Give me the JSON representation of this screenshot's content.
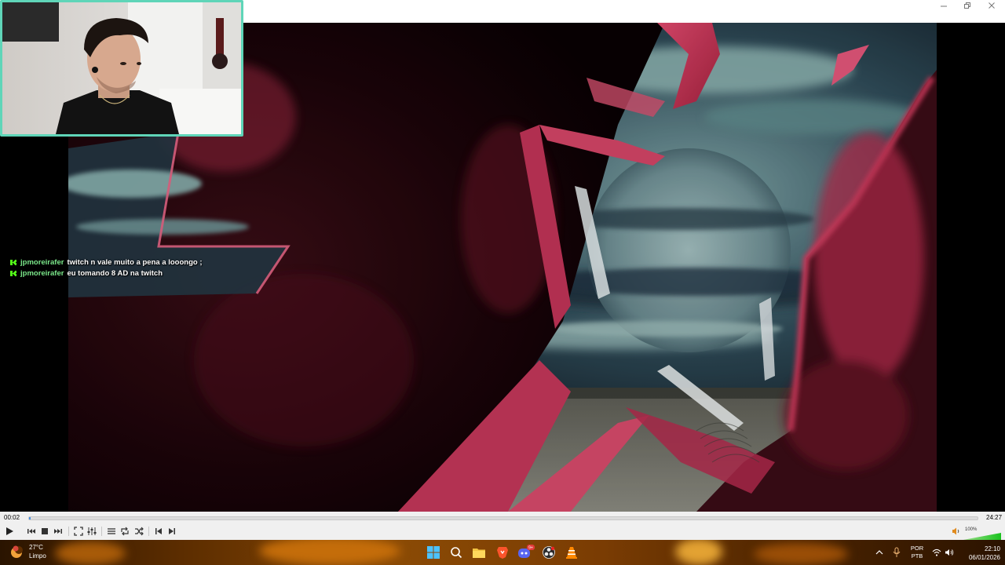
{
  "window": {
    "buttons": [
      "minimize",
      "restore",
      "close"
    ]
  },
  "webcam": {
    "icon": "webcam-feed"
  },
  "chat": {
    "messages": [
      {
        "user": "jpmoreirafer",
        "text": "twitch n vale muito a pena a looongo ;"
      },
      {
        "user": "jpmoreirafer",
        "text": "eu tomando 8 AD na twitch"
      }
    ],
    "user_color": "#7be88a"
  },
  "player": {
    "elapsed": "00:02",
    "duration": "24:27",
    "progress": 0.0014,
    "volume_label": "100%",
    "volume_level": 1.0,
    "buttons": [
      "play",
      "previous",
      "stop",
      "next",
      "fullscreen",
      "extended-settings",
      "playlist",
      "loop",
      "random",
      "frame-previous",
      "frame-next"
    ]
  },
  "taskbar": {
    "weather": {
      "temp": "27°C",
      "condition": "Limpo"
    },
    "apps": [
      "start",
      "search",
      "file-explorer",
      "brave",
      "discord",
      "obs",
      "vlc"
    ],
    "discord_badge": "9+",
    "language": {
      "line1": "POR",
      "line2": "PTB"
    },
    "time": "22:10",
    "date": "06/01/2026"
  },
  "colors": {
    "accent": "#5fd5b8",
    "seek_fill": "#4a90e2",
    "video_red": "#c8325a"
  }
}
